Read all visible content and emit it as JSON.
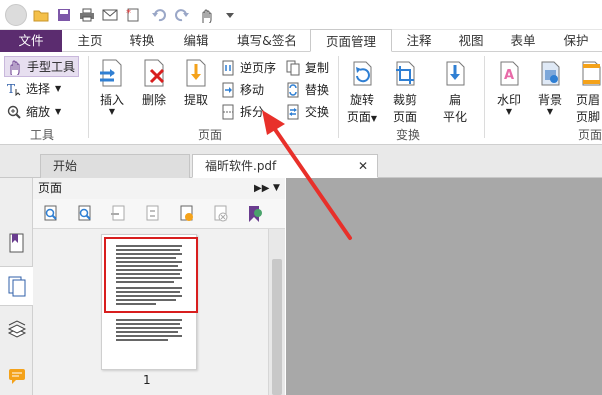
{
  "quick_access": {
    "icons": [
      "app-menu-icon",
      "open-folder-icon",
      "save-icon",
      "print-icon",
      "email-icon",
      "new-doc-icon",
      "undo-icon",
      "redo-icon",
      "hand-dropdown-icon",
      "customize-icon"
    ]
  },
  "tabs": [
    {
      "label": "文件"
    },
    {
      "label": "主页"
    },
    {
      "label": "转换"
    },
    {
      "label": "编辑"
    },
    {
      "label": "填写&签名"
    },
    {
      "label": "页面管理"
    },
    {
      "label": "注释"
    },
    {
      "label": "视图"
    },
    {
      "label": "表单"
    },
    {
      "label": "保护"
    }
  ],
  "ribbon": {
    "tools_group": {
      "hand": "手型工具",
      "select": "选择",
      "zoom": "缩放",
      "label": "工具"
    },
    "pages_group": {
      "insert": "插入",
      "delete": "删除",
      "extract": "提取",
      "reverse": "逆页序",
      "move": "移动",
      "split": "拆分",
      "copy": "复制",
      "replace": "替换",
      "swap": "交换",
      "label": "页面"
    },
    "transform_group": {
      "rotate_l1": "旋转",
      "rotate_l2": "页面",
      "crop_l1": "裁剪",
      "crop_l2": "页面",
      "flatten_l1": "扁",
      "flatten_l2": "平化",
      "label": "变换"
    },
    "other_group": {
      "watermark": "水印",
      "background": "背景",
      "headerfooter_l1": "页眉",
      "headerfooter_l2": "页脚",
      "label_partial": "页面标"
    }
  },
  "doc_tabs": [
    {
      "label": "开始"
    },
    {
      "label": "福昕软件.pdf"
    }
  ],
  "panel": {
    "title": "页面",
    "page_number": "1"
  },
  "colors": {
    "file_tab": "#5b2c6f",
    "accent_blue": "#2f7fd3",
    "accent_red": "#d81e1e",
    "main_area": "#a8a8a8"
  }
}
